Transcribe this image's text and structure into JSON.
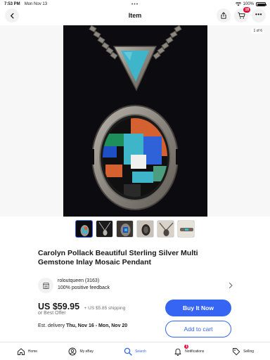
{
  "status_bar": {
    "time": "7:53 PM",
    "date": "Mon Nov 13",
    "battery": "100%"
  },
  "nav": {
    "title": "Item",
    "cart_count": "18"
  },
  "gallery": {
    "image_counter": "1 of 6",
    "thumbnail_count": 6,
    "selected_index": 0
  },
  "item": {
    "title": "Carolyn Pollack Beautiful Sterling Silver Multi Gemstone Inlay Mosaic Pendant"
  },
  "seller": {
    "name": "roloutqueen (3163)",
    "feedback": "100% positive feedback"
  },
  "price": {
    "amount": "US $59.95",
    "shipping": "+ US $5.85 shipping",
    "best_offer": "or Best Offer"
  },
  "delivery": {
    "label": "Est. delivery",
    "dates": "Thu, Nov 16 - Mon, Nov 20"
  },
  "actions": {
    "buy_now": "Buy It Now",
    "add_to_cart": "Add to cart"
  },
  "tabs": [
    {
      "label": "Home",
      "icon": "home-icon"
    },
    {
      "label": "My eBay",
      "icon": "user-icon"
    },
    {
      "label": "Search",
      "icon": "search-icon"
    },
    {
      "label": "Notifications",
      "icon": "bell-icon",
      "badge": "1"
    },
    {
      "label": "Selling",
      "icon": "tag-icon"
    }
  ],
  "colors": {
    "accent": "#3665f3",
    "badge": "#e0103a",
    "turquoise": "#3fb5c9",
    "coral": "#d4612f",
    "lapis": "#1f4fc4",
    "malachite": "#1e8f5a",
    "silver": "#9b9791"
  }
}
